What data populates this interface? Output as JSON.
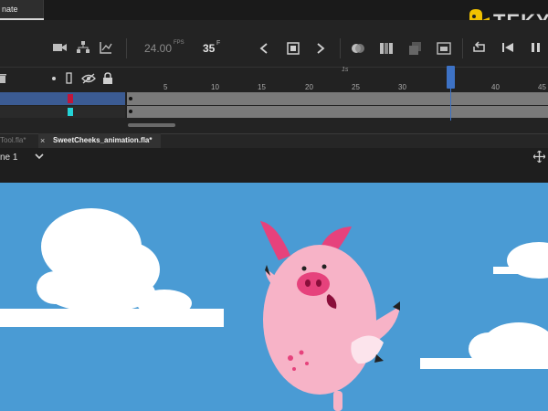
{
  "app": {
    "workspace_tab": "nate",
    "logo_text": "TEKY"
  },
  "timeline": {
    "fps_value": "24.00",
    "fps_unit": "FPS",
    "current_frame": "35",
    "frame_unit": "F",
    "seconds_marker": "1s",
    "ruler_labels": [
      "5",
      "10",
      "15",
      "20",
      "25",
      "30",
      "40",
      "45"
    ],
    "layers": [
      {
        "color": "#c0163a",
        "selected": true
      },
      {
        "color": "#24d3d6",
        "selected": false
      }
    ]
  },
  "documents": {
    "tabs": [
      {
        "label": "Tool.fla*",
        "active": false
      },
      {
        "label": "SweetCheeks_animation.fla*",
        "active": true
      }
    ],
    "close_glyph": "×"
  },
  "scene": {
    "label": "ne 1"
  },
  "colors": {
    "sky": "#4a9bd4",
    "pig_body": "#f7b3c7",
    "ears": "#e6427c",
    "layer_selected": "#3b5b93",
    "playhead": "#3d72c5"
  }
}
